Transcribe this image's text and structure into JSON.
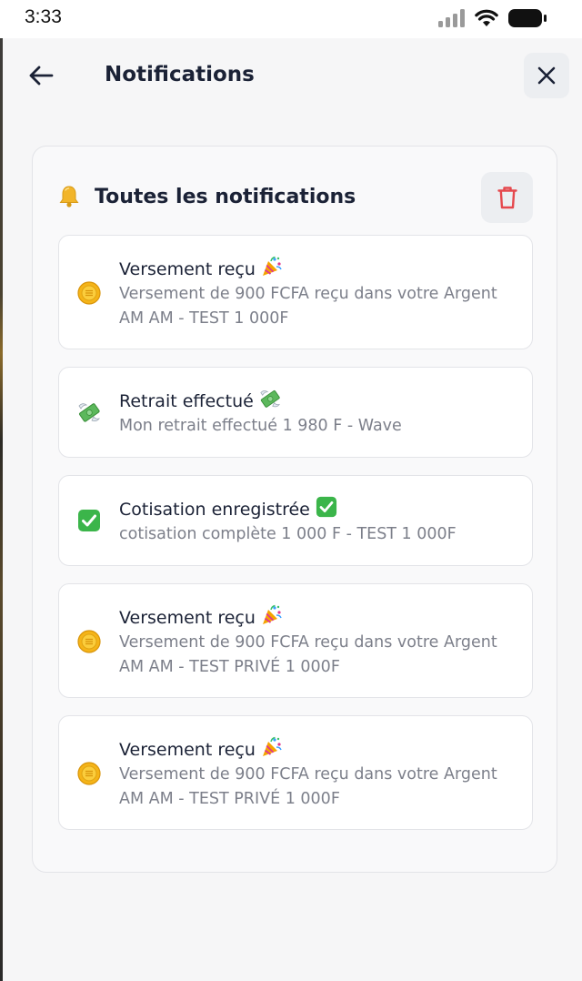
{
  "status_bar": {
    "time": "3:33"
  },
  "header": {
    "title": "Notifications"
  },
  "card": {
    "title": "Toutes les notifications"
  },
  "notifications": [
    {
      "icon": "coin-icon",
      "title": "Versement reçu",
      "title_emoji": "party-popper-icon",
      "body": "Versement de 900 FCFA reçu dans votre Argent AM AM - TEST 1 000F"
    },
    {
      "icon": "money-with-wings-icon",
      "title": "Retrait effectué",
      "title_emoji": "money-with-wings-icon",
      "body": "Mon retrait effectué 1 980 F - Wave"
    },
    {
      "icon": "check-mark-icon",
      "title": "Cotisation enregistrée",
      "title_emoji": "check-mark-icon",
      "body": "cotisation complète 1 000 F - TEST 1 000F"
    },
    {
      "icon": "coin-icon",
      "title": "Versement reçu",
      "title_emoji": "party-popper-icon",
      "body": "Versement de 900 FCFA reçu dans votre Argent AM AM - TEST PRIVÉ 1 000F"
    },
    {
      "icon": "coin-icon",
      "title": "Versement reçu",
      "title_emoji": "party-popper-icon",
      "body": "Versement de 900 FCFA reçu dans votre Argent AM AM - TEST PRIVÉ 1 000F"
    }
  ],
  "colors": {
    "accent_red": "#e5484d",
    "title": "#1b2236",
    "body": "#7c7f8a",
    "card_border": "#e3e4e8"
  }
}
